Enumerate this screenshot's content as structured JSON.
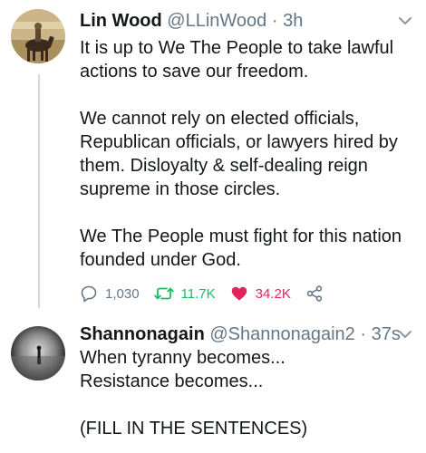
{
  "tweets": [
    {
      "display_name": "Lin Wood",
      "handle": "@LLinWood",
      "separator": "·",
      "time": "3h",
      "lines": [
        "It is up to We The People to take lawful",
        "actions to save our freedom.",
        "",
        "We cannot rely on elected officials,",
        "Republican officials, or lawyers hired by",
        "them. Disloyalty & self-dealing reign",
        "supreme in those circles.",
        "",
        "We The People must fight for this nation",
        "founded under God."
      ],
      "replies": "1,030",
      "retweets": "11.7K",
      "likes": "34.2K",
      "avatar_icon": "horse-rider-avatar"
    },
    {
      "display_name": "Shannonagain",
      "handle": "@Shannonagain2",
      "separator": "·",
      "time": "37s",
      "lines": [
        "When tyranny becomes...",
        "Resistance becomes...",
        "",
        "(FILL IN THE SENTENCES)"
      ],
      "avatar_icon": "silhouette-avatar"
    }
  ],
  "colors": {
    "text": "#14171a",
    "muted": "#657786",
    "retweet": "#17bf63",
    "like": "#e0245e",
    "thread_line": "#cfd9de"
  }
}
